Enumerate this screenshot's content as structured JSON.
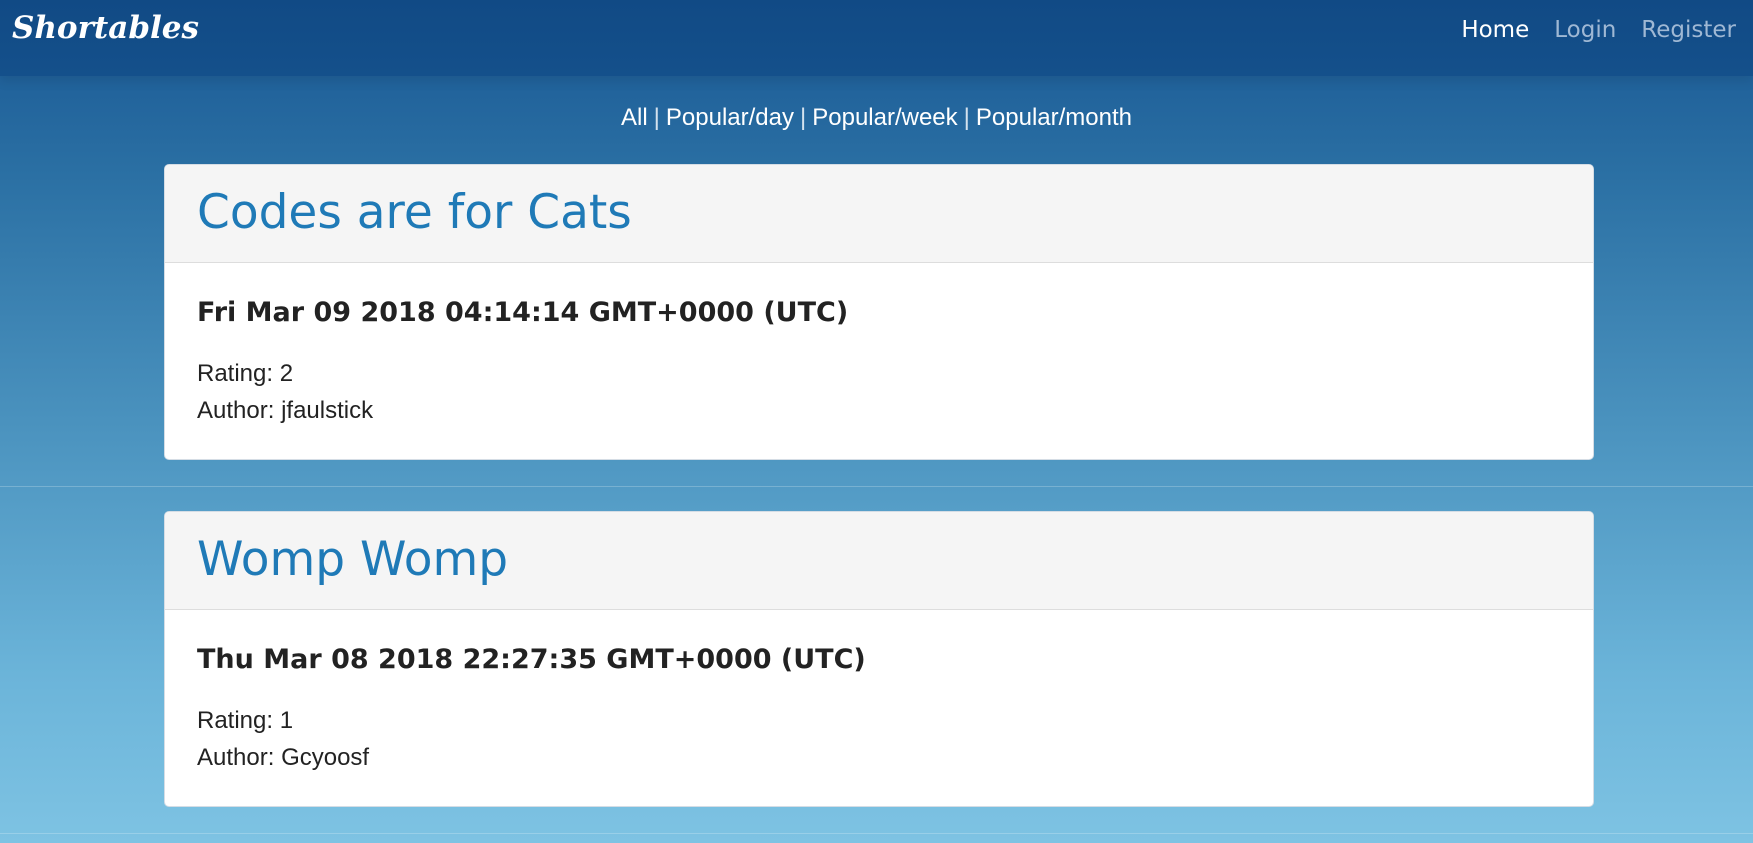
{
  "navbar": {
    "brand": "Shortables",
    "links": [
      {
        "label": "Home",
        "active": true
      },
      {
        "label": "Login",
        "active": false
      },
      {
        "label": "Register",
        "active": false
      }
    ]
  },
  "filters": {
    "items": [
      "All",
      "Popular/day",
      "Popular/week",
      "Popular/month"
    ],
    "separator": "|"
  },
  "posts": [
    {
      "title": "Codes are for Cats",
      "date": "Fri Mar 09 2018 04:14:14 GMT+0000 (UTC)",
      "rating_label": "Rating:",
      "rating": "2",
      "author_label": "Author:",
      "author": "jfaulstick"
    },
    {
      "title": "Womp Womp",
      "date": "Thu Mar 08 2018 22:27:35 GMT+0000 (UTC)",
      "rating_label": "Rating:",
      "rating": "1",
      "author_label": "Author:",
      "author": "Gcyoosf"
    }
  ],
  "colors": {
    "nav_bg": "#114a85",
    "accent_title": "#1f7ab7",
    "text": "#222222",
    "inactive_link": "#9fb8d4"
  }
}
